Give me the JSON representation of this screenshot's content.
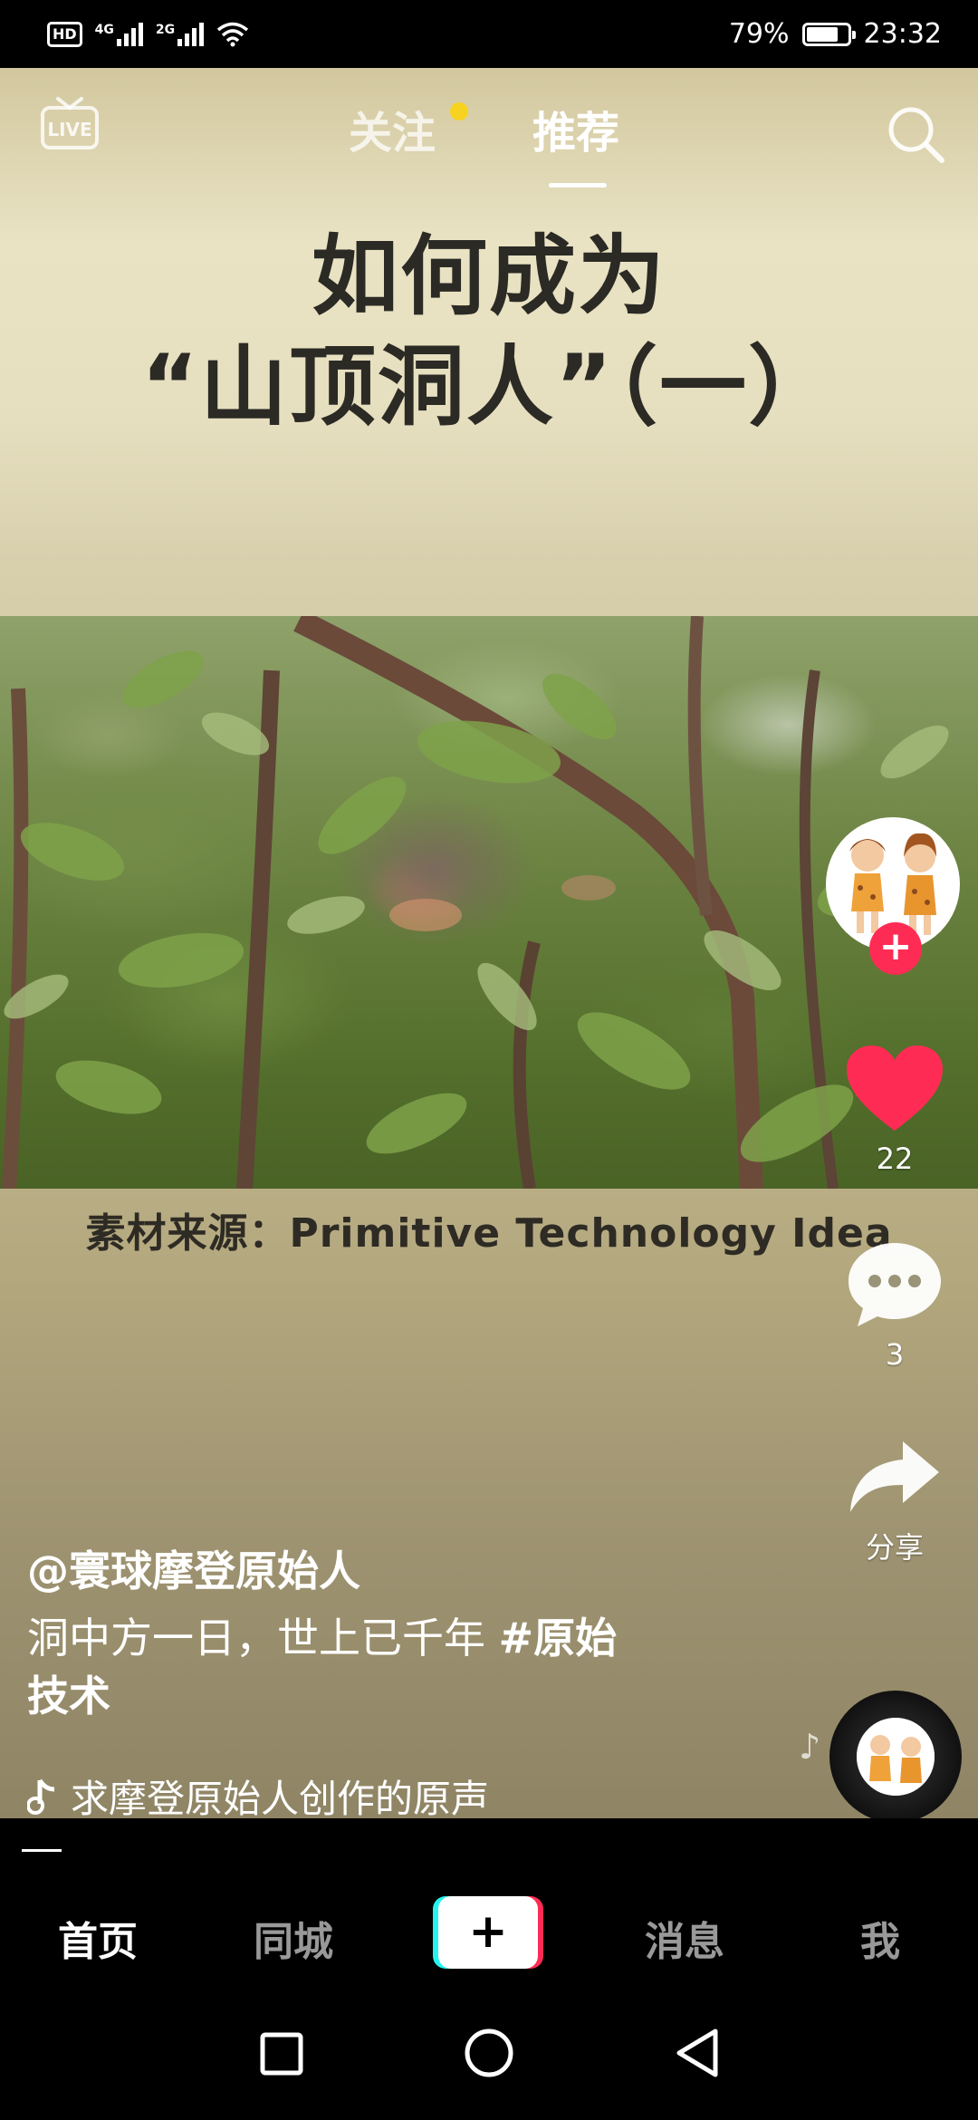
{
  "status_bar": {
    "hd_badge": "HD",
    "net1": "4G",
    "net2": "2G",
    "battery_percent": "79%",
    "battery_level": 0.79,
    "time": "23:32"
  },
  "top_nav": {
    "live_label": "LIVE",
    "tab_follow": "关注",
    "tab_recommend": "推荐",
    "active_tab": "推荐"
  },
  "video": {
    "title_line1": "如何成为",
    "title_line2": "“山顶洞人”（一）",
    "source_caption": "素材来源：Primitive Technology Idea"
  },
  "actions": {
    "like_count": "22",
    "comment_count": "3",
    "share_label": "分享",
    "follow_plus": "+"
  },
  "post": {
    "author": "@寰球摩登原始人",
    "description_text": "洞中方一日，世上已千年 ",
    "hashtag_line1": "#原始",
    "hashtag_line2": "技术",
    "music_text": "求摩登原始人创作的原声"
  },
  "bottom_tabs": {
    "home": "首页",
    "city": "同城",
    "create": "+",
    "messages": "消息",
    "me": "我"
  },
  "colors": {
    "accent_red": "#fe2c55",
    "accent_cyan": "#25f4ee",
    "follow_dot": "#f7d21f"
  }
}
